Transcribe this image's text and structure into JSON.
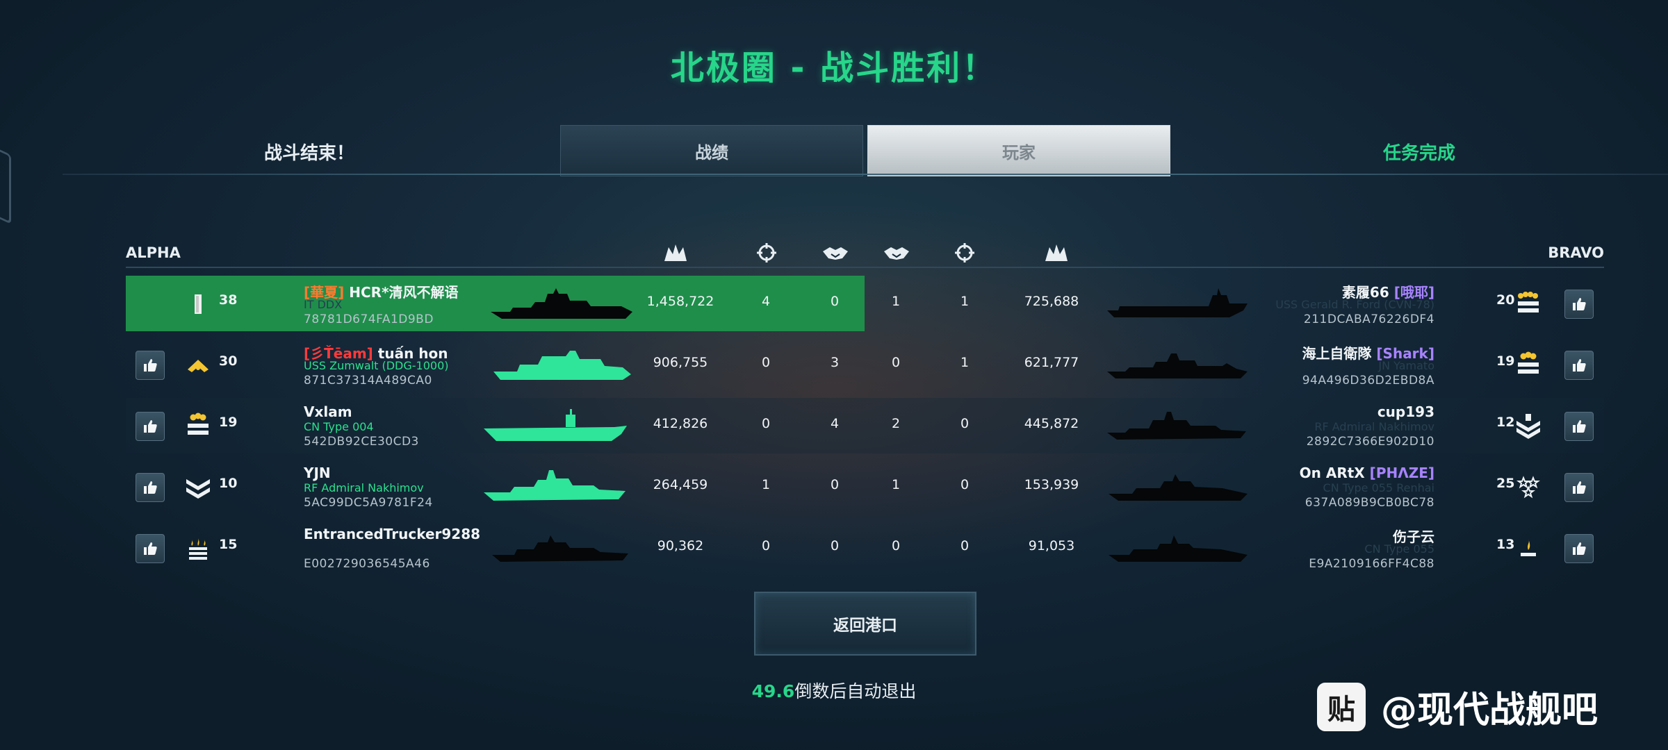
{
  "title": "北极圈 - 战斗胜利！",
  "battle_over": "战斗结束！",
  "mission_complete": "任务完成",
  "tabs": [
    {
      "label": "战绩",
      "active": false
    },
    {
      "label": "玩家",
      "active": true
    }
  ],
  "teams": {
    "alpha": "ALPHA",
    "bravo": "BRAVO"
  },
  "header_icons": [
    "damage-icon",
    "crosshair-icon",
    "handshake-icon",
    "handshake-icon",
    "crosshair-icon",
    "damage-icon"
  ],
  "rows": [
    {
      "highlight": true,
      "alpha": {
        "like": false,
        "rank_icon": "bar-rank-icon",
        "level": "38",
        "tag": "[華夏]",
        "tag_color": "orange",
        "name": "HCR*清风不解语",
        "ship": "IT DDX",
        "ship_visible": false,
        "id": "78781D674FA1D9BD",
        "ship_color": "#000000",
        "damage": "1,458,722",
        "kills": "4",
        "assists": "0"
      },
      "bravo": {
        "assists": "1",
        "kills": "1",
        "damage": "725,688",
        "name": "素履66",
        "tag": "[哦耶]",
        "ship": "USS Gerald R. Ford (CVN-78)",
        "id": "211DCABA76226DF4",
        "level": "20",
        "rank_icon": "stars-bars-rank-icon"
      }
    },
    {
      "highlight": false,
      "alpha": {
        "like": true,
        "rank_icon": "chevron-rank-icon",
        "level": "30",
        "tag": "[彡Ťēam]",
        "tag_color": "red",
        "name": "tuấn hon",
        "ship": "USS Zumwalt (DDG-1000)",
        "ship_visible": true,
        "id": "871C37314A489CA0",
        "ship_color": "#2ee59a",
        "damage": "906,755",
        "kills": "0",
        "assists": "3"
      },
      "bravo": {
        "assists": "0",
        "kills": "1",
        "damage": "621,777",
        "name": "海上自衛隊",
        "tag": "[Shark]",
        "ship": "JN Yamato",
        "id": "94A496D36D2EBD8A",
        "level": "19",
        "rank_icon": "stars-bars-rank-icon"
      }
    },
    {
      "highlight": false,
      "alpha": {
        "like": true,
        "rank_icon": "stars-bars-rank-icon",
        "level": "19",
        "tag": "",
        "tag_color": "",
        "name": "Vxlam",
        "ship": "CN Type 004",
        "ship_visible": true,
        "id": "542DB92CE30CD3",
        "ship_color": "#2ee59a",
        "damage": "412,826",
        "kills": "0",
        "assists": "4"
      },
      "bravo": {
        "assists": "2",
        "kills": "0",
        "damage": "445,872",
        "name": "cup193",
        "tag": "",
        "ship": "RF Admiral Nakhimov",
        "id": "2892C7366E902D10",
        "level": "12",
        "rank_icon": "chevrons-rank-icon"
      }
    },
    {
      "highlight": false,
      "alpha": {
        "like": true,
        "rank_icon": "chevrons-rank-icon",
        "level": "10",
        "tag": "",
        "tag_color": "",
        "name": "YJN",
        "ship": "RF Admiral Nakhimov",
        "ship_visible": true,
        "id": "5AC99DC5A9781F24",
        "ship_color": "#2ee59a",
        "damage": "264,459",
        "kills": "1",
        "assists": "0"
      },
      "bravo": {
        "assists": "1",
        "kills": "0",
        "damage": "153,939",
        "name": "On ARtX",
        "tag": "[PHΛZE]",
        "ship": "CN Type 055 Renhai",
        "id": "637A089B9CB0BC78",
        "level": "25",
        "rank_icon": "stars-rank-icon"
      }
    },
    {
      "highlight": false,
      "alpha": {
        "like": true,
        "rank_icon": "flame-rank-icon",
        "level": "15",
        "tag": "",
        "tag_color": "",
        "name": "EntrancedTrucker9288",
        "ship": "",
        "ship_visible": false,
        "id": "E002729036545A46",
        "ship_color": "#000000",
        "damage": "90,362",
        "kills": "0",
        "assists": "0"
      },
      "bravo": {
        "assists": "0",
        "kills": "0",
        "damage": "91,053",
        "name": "伤子云",
        "tag": "",
        "ship": "CN Type 055",
        "id": "E9A2109166FF4C88",
        "level": "13",
        "rank_icon": "single-flame-rank-icon"
      }
    }
  ],
  "return_button": "返回港口",
  "countdown_value": "49.6",
  "countdown_text": "倒数后自动退出",
  "watermark": {
    "logo": "贴",
    "text": "@现代战舰吧"
  }
}
